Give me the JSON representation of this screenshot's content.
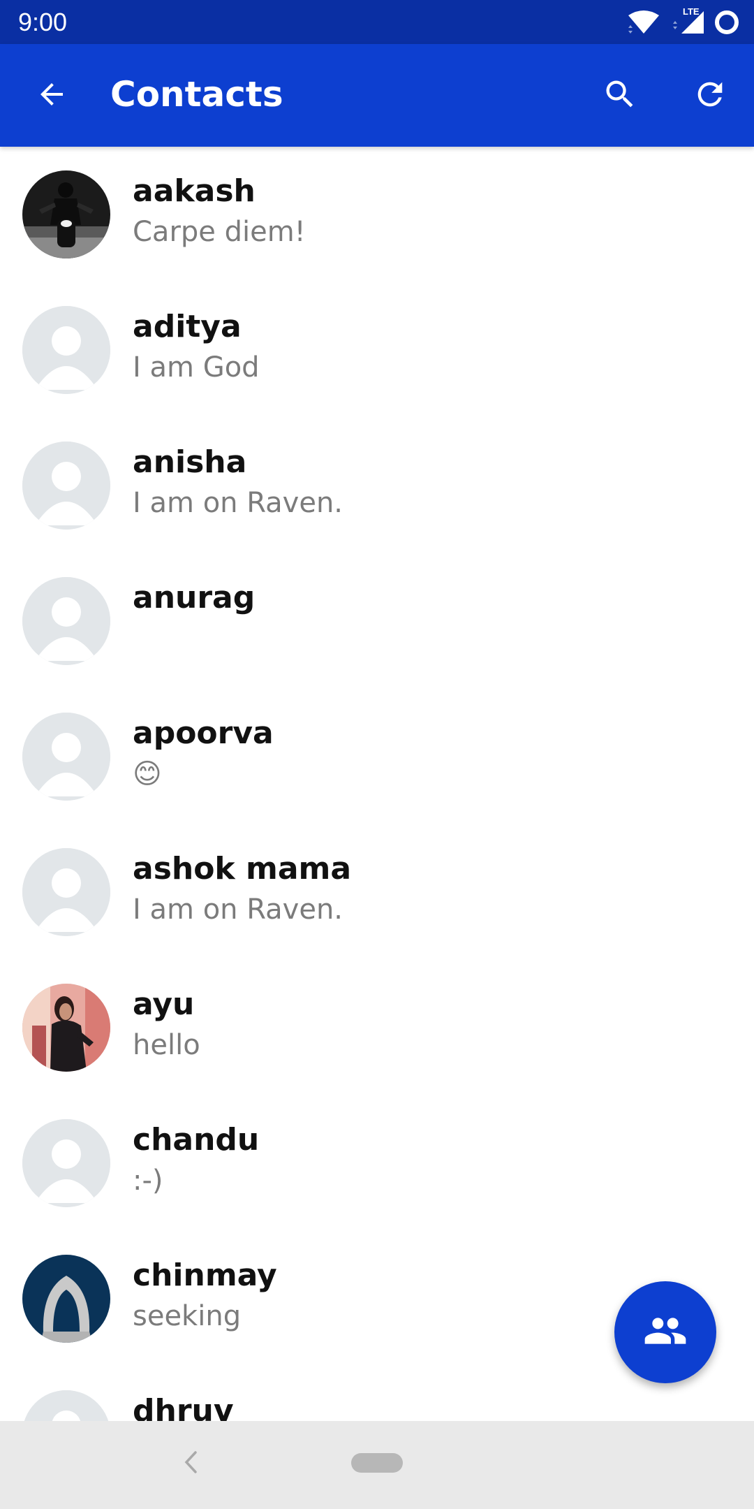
{
  "status_bar": {
    "time": "9:00",
    "network_label": "LTE",
    "icons": [
      "wifi-icon",
      "signal-icon",
      "battery-circle-icon"
    ]
  },
  "app_bar": {
    "title": "Contacts",
    "back_icon": "arrow-back-icon",
    "search_icon": "search-icon",
    "refresh_icon": "refresh-icon",
    "color": "#0d3fd0"
  },
  "contacts": [
    {
      "name": "aakash",
      "status": "Carpe diem!",
      "avatar": "photo-motorcycle"
    },
    {
      "name": "aditya",
      "status": "I am God",
      "avatar": "default-person"
    },
    {
      "name": "anisha",
      "status": "I am on Raven.",
      "avatar": "default-person"
    },
    {
      "name": "anurag",
      "status": "",
      "avatar": "default-person"
    },
    {
      "name": "apoorva",
      "status": "😊",
      "avatar": "default-person"
    },
    {
      "name": "ashok mama",
      "status": "I am on Raven.",
      "avatar": "default-person"
    },
    {
      "name": "ayu",
      "status": "hello",
      "avatar": "photo-person"
    },
    {
      "name": "chandu",
      "status": ":-)",
      "avatar": "default-person"
    },
    {
      "name": "chinmay",
      "status": "seeking",
      "avatar": "photo-hooded-figure"
    },
    {
      "name": "dhruv",
      "status": "",
      "avatar": "default-person"
    }
  ],
  "fab": {
    "icon": "group-icon",
    "color": "#0d3fd0"
  },
  "nav_bar": {
    "back_icon": "nav-back-chevron-icon",
    "home_icon": "home-pill-icon"
  }
}
